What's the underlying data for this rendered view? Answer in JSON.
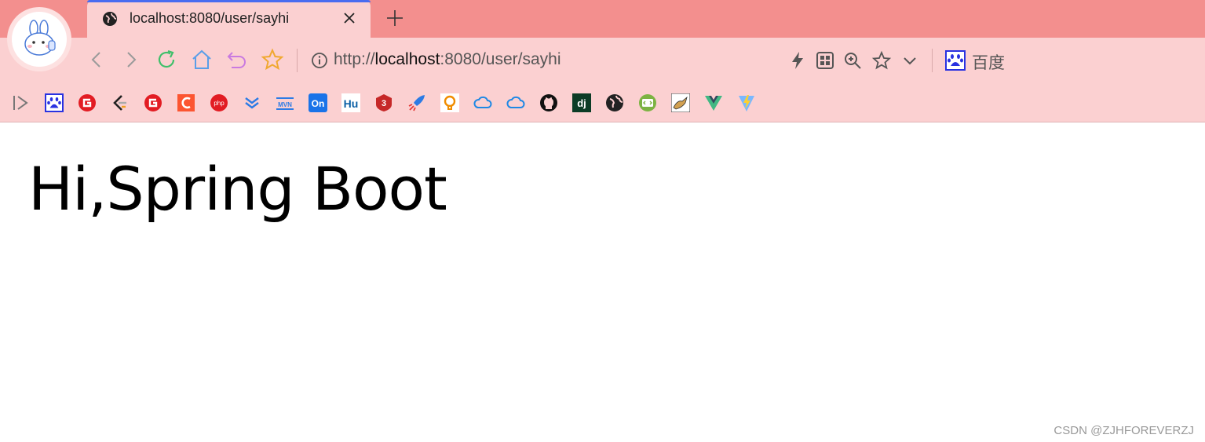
{
  "tab": {
    "title": "localhost:8080/user/sayhi"
  },
  "address_bar": {
    "scheme": "http://",
    "host": "localhost",
    "rest": ":8080/user/sayhi"
  },
  "search_engine": {
    "label": "百度"
  },
  "bookmarks": [
    {
      "icon": "expand-icon"
    },
    {
      "icon": "baidu-paw-icon"
    },
    {
      "icon": "red-g-icon"
    },
    {
      "icon": "leetcode-icon"
    },
    {
      "icon": "red-g-icon-2"
    },
    {
      "icon": "csdn-c-icon"
    },
    {
      "icon": "php-icon"
    },
    {
      "icon": "chevrons-icon"
    },
    {
      "icon": "mvn-icon",
      "text": "MVN"
    },
    {
      "icon": "on-icon",
      "text": "On"
    },
    {
      "icon": "hu-icon",
      "text": "Hu"
    },
    {
      "icon": "shield-3-icon"
    },
    {
      "icon": "rocket-icon"
    },
    {
      "icon": "lightbulb-icon"
    },
    {
      "icon": "cloud-icon"
    },
    {
      "icon": "cloud-icon-2"
    },
    {
      "icon": "github-icon"
    },
    {
      "icon": "dj-icon",
      "text": "dj"
    },
    {
      "icon": "globe-icon"
    },
    {
      "icon": "code-icon"
    },
    {
      "icon": "tomcat-icon"
    },
    {
      "icon": "vue-icon"
    },
    {
      "icon": "vite-icon"
    }
  ],
  "page": {
    "heading": "Hi,Spring Boot"
  },
  "watermark": "CSDN @ZJHFOREVERZJ",
  "colors": {
    "tabstrip": "#f38f8e",
    "toolbar": "#fbd0d1",
    "accent": "#4a6cf0"
  }
}
